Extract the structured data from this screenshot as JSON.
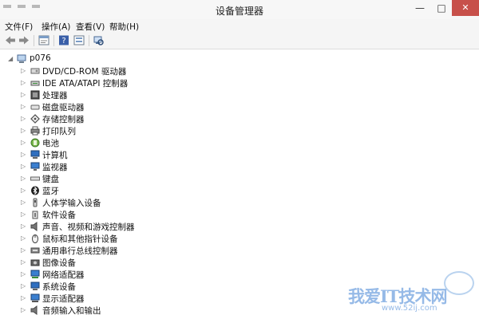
{
  "window": {
    "title": "设备管理器",
    "minimize_glyph": "—",
    "maximize_glyph": "□",
    "close_glyph": "✕"
  },
  "menu": [
    {
      "label": "文件(F)"
    },
    {
      "label": "操作(A)"
    },
    {
      "label": "查看(V)"
    },
    {
      "label": "帮助(H)"
    }
  ],
  "toolbar": {
    "icons": [
      "back-arrow-icon",
      "forward-arrow-icon",
      "properties-icon",
      "help-icon",
      "view-icon",
      "scan-hardware-icon"
    ]
  },
  "tree": {
    "root": {
      "label": "p076",
      "expander": "◢",
      "icon": "computer-icon"
    },
    "collapsed_glyph": "▷",
    "items": [
      {
        "label": "DVD/CD-ROM 驱动器",
        "icon": "dvd-drive-icon"
      },
      {
        "label": "IDE ATA/ATAPI 控制器",
        "icon": "ide-controller-icon"
      },
      {
        "label": "处理器",
        "icon": "processor-icon"
      },
      {
        "label": "磁盘驱动器",
        "icon": "disk-drive-icon"
      },
      {
        "label": "存储控制器",
        "icon": "storage-controller-icon"
      },
      {
        "label": "打印队列",
        "icon": "printer-icon"
      },
      {
        "label": "电池",
        "icon": "battery-icon"
      },
      {
        "label": "计算机",
        "icon": "computer-icon"
      },
      {
        "label": "监视器",
        "icon": "monitor-icon"
      },
      {
        "label": "键盘",
        "icon": "keyboard-icon"
      },
      {
        "label": "蓝牙",
        "icon": "bluetooth-icon"
      },
      {
        "label": "人体学输入设备",
        "icon": "hid-icon"
      },
      {
        "label": "软件设备",
        "icon": "software-device-icon"
      },
      {
        "label": "声音、视频和游戏控制器",
        "icon": "sound-icon"
      },
      {
        "label": "鼠标和其他指针设备",
        "icon": "mouse-icon"
      },
      {
        "label": "通用串行总线控制器",
        "icon": "usb-icon"
      },
      {
        "label": "图像设备",
        "icon": "camera-icon"
      },
      {
        "label": "网络适配器",
        "icon": "network-adapter-icon"
      },
      {
        "label": "系统设备",
        "icon": "system-device-icon"
      },
      {
        "label": "显示适配器",
        "icon": "display-adapter-icon"
      },
      {
        "label": "音频输入和输出",
        "icon": "audio-io-icon"
      }
    ]
  },
  "watermark": {
    "text": "我爱IT技术网",
    "url": "www.52ij.com"
  }
}
